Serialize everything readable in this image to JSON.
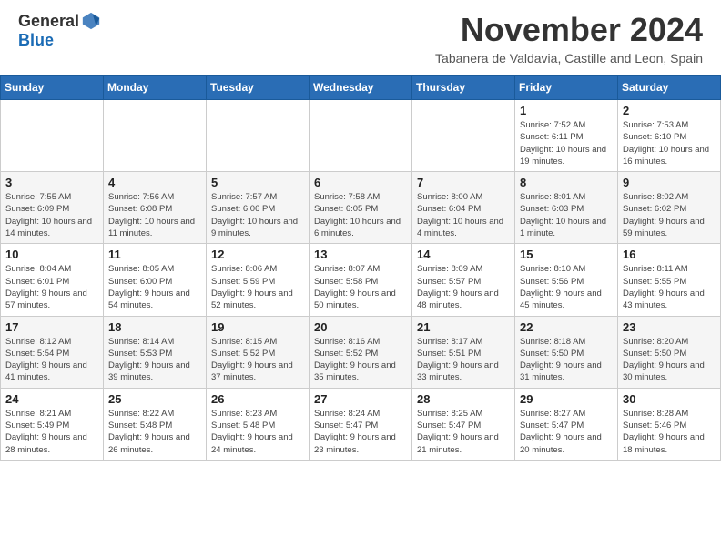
{
  "header": {
    "logo_general": "General",
    "logo_blue": "Blue",
    "month_title": "November 2024",
    "subtitle": "Tabanera de Valdavia, Castille and Leon, Spain"
  },
  "days_of_week": [
    "Sunday",
    "Monday",
    "Tuesday",
    "Wednesday",
    "Thursday",
    "Friday",
    "Saturday"
  ],
  "weeks": [
    [
      {
        "day": "",
        "info": ""
      },
      {
        "day": "",
        "info": ""
      },
      {
        "day": "",
        "info": ""
      },
      {
        "day": "",
        "info": ""
      },
      {
        "day": "",
        "info": ""
      },
      {
        "day": "1",
        "info": "Sunrise: 7:52 AM\nSunset: 6:11 PM\nDaylight: 10 hours and 19 minutes."
      },
      {
        "day": "2",
        "info": "Sunrise: 7:53 AM\nSunset: 6:10 PM\nDaylight: 10 hours and 16 minutes."
      }
    ],
    [
      {
        "day": "3",
        "info": "Sunrise: 7:55 AM\nSunset: 6:09 PM\nDaylight: 10 hours and 14 minutes."
      },
      {
        "day": "4",
        "info": "Sunrise: 7:56 AM\nSunset: 6:08 PM\nDaylight: 10 hours and 11 minutes."
      },
      {
        "day": "5",
        "info": "Sunrise: 7:57 AM\nSunset: 6:06 PM\nDaylight: 10 hours and 9 minutes."
      },
      {
        "day": "6",
        "info": "Sunrise: 7:58 AM\nSunset: 6:05 PM\nDaylight: 10 hours and 6 minutes."
      },
      {
        "day": "7",
        "info": "Sunrise: 8:00 AM\nSunset: 6:04 PM\nDaylight: 10 hours and 4 minutes."
      },
      {
        "day": "8",
        "info": "Sunrise: 8:01 AM\nSunset: 6:03 PM\nDaylight: 10 hours and 1 minute."
      },
      {
        "day": "9",
        "info": "Sunrise: 8:02 AM\nSunset: 6:02 PM\nDaylight: 9 hours and 59 minutes."
      }
    ],
    [
      {
        "day": "10",
        "info": "Sunrise: 8:04 AM\nSunset: 6:01 PM\nDaylight: 9 hours and 57 minutes."
      },
      {
        "day": "11",
        "info": "Sunrise: 8:05 AM\nSunset: 6:00 PM\nDaylight: 9 hours and 54 minutes."
      },
      {
        "day": "12",
        "info": "Sunrise: 8:06 AM\nSunset: 5:59 PM\nDaylight: 9 hours and 52 minutes."
      },
      {
        "day": "13",
        "info": "Sunrise: 8:07 AM\nSunset: 5:58 PM\nDaylight: 9 hours and 50 minutes."
      },
      {
        "day": "14",
        "info": "Sunrise: 8:09 AM\nSunset: 5:57 PM\nDaylight: 9 hours and 48 minutes."
      },
      {
        "day": "15",
        "info": "Sunrise: 8:10 AM\nSunset: 5:56 PM\nDaylight: 9 hours and 45 minutes."
      },
      {
        "day": "16",
        "info": "Sunrise: 8:11 AM\nSunset: 5:55 PM\nDaylight: 9 hours and 43 minutes."
      }
    ],
    [
      {
        "day": "17",
        "info": "Sunrise: 8:12 AM\nSunset: 5:54 PM\nDaylight: 9 hours and 41 minutes."
      },
      {
        "day": "18",
        "info": "Sunrise: 8:14 AM\nSunset: 5:53 PM\nDaylight: 9 hours and 39 minutes."
      },
      {
        "day": "19",
        "info": "Sunrise: 8:15 AM\nSunset: 5:52 PM\nDaylight: 9 hours and 37 minutes."
      },
      {
        "day": "20",
        "info": "Sunrise: 8:16 AM\nSunset: 5:52 PM\nDaylight: 9 hours and 35 minutes."
      },
      {
        "day": "21",
        "info": "Sunrise: 8:17 AM\nSunset: 5:51 PM\nDaylight: 9 hours and 33 minutes."
      },
      {
        "day": "22",
        "info": "Sunrise: 8:18 AM\nSunset: 5:50 PM\nDaylight: 9 hours and 31 minutes."
      },
      {
        "day": "23",
        "info": "Sunrise: 8:20 AM\nSunset: 5:50 PM\nDaylight: 9 hours and 30 minutes."
      }
    ],
    [
      {
        "day": "24",
        "info": "Sunrise: 8:21 AM\nSunset: 5:49 PM\nDaylight: 9 hours and 28 minutes."
      },
      {
        "day": "25",
        "info": "Sunrise: 8:22 AM\nSunset: 5:48 PM\nDaylight: 9 hours and 26 minutes."
      },
      {
        "day": "26",
        "info": "Sunrise: 8:23 AM\nSunset: 5:48 PM\nDaylight: 9 hours and 24 minutes."
      },
      {
        "day": "27",
        "info": "Sunrise: 8:24 AM\nSunset: 5:47 PM\nDaylight: 9 hours and 23 minutes."
      },
      {
        "day": "28",
        "info": "Sunrise: 8:25 AM\nSunset: 5:47 PM\nDaylight: 9 hours and 21 minutes."
      },
      {
        "day": "29",
        "info": "Sunrise: 8:27 AM\nSunset: 5:47 PM\nDaylight: 9 hours and 20 minutes."
      },
      {
        "day": "30",
        "info": "Sunrise: 8:28 AM\nSunset: 5:46 PM\nDaylight: 9 hours and 18 minutes."
      }
    ]
  ]
}
